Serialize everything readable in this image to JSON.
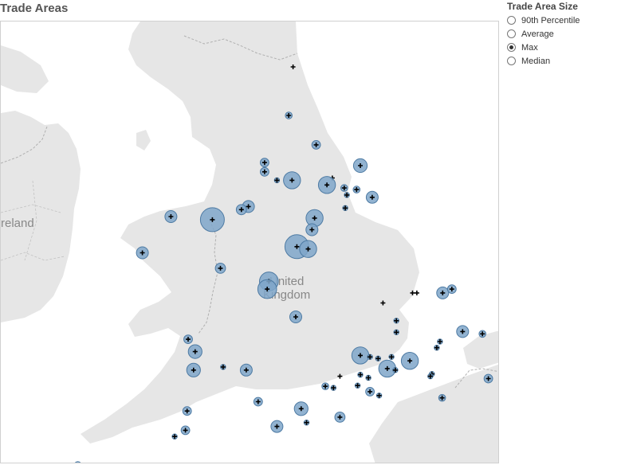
{
  "title": "Trade Areas",
  "legend": {
    "title": "Trade Area Size",
    "options": [
      "90th Percentile",
      "Average",
      "Max",
      "Median"
    ],
    "selected": "Max"
  },
  "map_labels": {
    "ireland": "reland",
    "uk_line1": "United",
    "uk_line2": "Kingdom"
  },
  "colors": {
    "land": "#e6e6e6",
    "sea": "#ffffff",
    "trade_area_fill": "#7fa6c9",
    "trade_area_stroke": "#4d7aa3",
    "store_marker": "#000000"
  },
  "trade_areas": [
    {
      "lat": 55.26,
      "lon": -1.55,
      "radius_km": 0
    },
    {
      "lat": 54.63,
      "lon": -1.63,
      "radius_km": 4
    },
    {
      "lat": 54.25,
      "lon": -1.12,
      "radius_km": 5
    },
    {
      "lat": 54.02,
      "lon": -2.08,
      "radius_km": 5
    },
    {
      "lat": 53.98,
      "lon": -0.3,
      "radius_km": 8
    },
    {
      "lat": 53.9,
      "lon": -2.08,
      "radius_km": 5
    },
    {
      "lat": 53.79,
      "lon": -1.85,
      "radius_km": 3
    },
    {
      "lat": 53.79,
      "lon": -1.57,
      "radius_km": 10
    },
    {
      "lat": 53.82,
      "lon": -0.82,
      "radius_km": 0
    },
    {
      "lat": 53.73,
      "lon": -0.92,
      "radius_km": 10
    },
    {
      "lat": 53.69,
      "lon": -0.6,
      "radius_km": 4
    },
    {
      "lat": 53.67,
      "lon": -0.37,
      "radius_km": 4
    },
    {
      "lat": 53.57,
      "lon": -0.08,
      "radius_km": 7
    },
    {
      "lat": 53.6,
      "lon": -0.55,
      "radius_km": 3
    },
    {
      "lat": 53.45,
      "lon": -2.38,
      "radius_km": 7
    },
    {
      "lat": 53.41,
      "lon": -2.51,
      "radius_km": 6
    },
    {
      "lat": 53.43,
      "lon": -0.58,
      "radius_km": 3
    },
    {
      "lat": 53.32,
      "lon": -3.82,
      "radius_km": 7
    },
    {
      "lat": 53.28,
      "lon": -3.05,
      "radius_km": 14
    },
    {
      "lat": 53.3,
      "lon": -1.15,
      "radius_km": 10
    },
    {
      "lat": 53.15,
      "lon": -1.2,
      "radius_km": 7
    },
    {
      "lat": 52.93,
      "lon": -1.48,
      "radius_km": 14
    },
    {
      "lat": 52.9,
      "lon": -1.27,
      "radius_km": 10
    },
    {
      "lat": 52.85,
      "lon": -4.35,
      "radius_km": 7
    },
    {
      "lat": 52.65,
      "lon": -2.9,
      "radius_km": 6
    },
    {
      "lat": 52.48,
      "lon": -2.0,
      "radius_km": 11
    },
    {
      "lat": 52.38,
      "lon": -2.03,
      "radius_km": 11
    },
    {
      "lat": 52.33,
      "lon": 1.23,
      "radius_km": 7
    },
    {
      "lat": 52.38,
      "lon": 1.4,
      "radius_km": 5
    },
    {
      "lat": 52.33,
      "lon": 0.75,
      "radius_km": 0
    },
    {
      "lat": 52.33,
      "lon": 0.67,
      "radius_km": 0
    },
    {
      "lat": 52.2,
      "lon": 0.12,
      "radius_km": 0
    },
    {
      "lat": 52.02,
      "lon": -1.5,
      "radius_km": 7
    },
    {
      "lat": 51.97,
      "lon": 0.37,
      "radius_km": 3
    },
    {
      "lat": 51.82,
      "lon": 0.37,
      "radius_km": 3
    },
    {
      "lat": 51.83,
      "lon": 1.6,
      "radius_km": 7
    },
    {
      "lat": 51.8,
      "lon": 1.97,
      "radius_km": 4
    },
    {
      "lat": 51.73,
      "lon": -3.5,
      "radius_km": 5
    },
    {
      "lat": 51.7,
      "lon": 1.18,
      "radius_km": 3
    },
    {
      "lat": 51.62,
      "lon": 1.12,
      "radius_km": 3
    },
    {
      "lat": 51.57,
      "lon": -3.37,
      "radius_km": 8
    },
    {
      "lat": 51.52,
      "lon": -0.3,
      "radius_km": 10
    },
    {
      "lat": 51.5,
      "lon": -0.12,
      "radius_km": 3
    },
    {
      "lat": 51.48,
      "lon": 0.03,
      "radius_km": 3
    },
    {
      "lat": 51.45,
      "lon": 0.62,
      "radius_km": 10
    },
    {
      "lat": 51.5,
      "lon": 0.28,
      "radius_km": 3
    },
    {
      "lat": 51.33,
      "lon": -3.4,
      "radius_km": 8
    },
    {
      "lat": 51.37,
      "lon": -2.85,
      "radius_km": 3
    },
    {
      "lat": 51.33,
      "lon": -2.42,
      "radius_km": 7
    },
    {
      "lat": 51.35,
      "lon": 0.2,
      "radius_km": 10
    },
    {
      "lat": 51.33,
      "lon": 0.35,
      "radius_km": 3
    },
    {
      "lat": 51.28,
      "lon": 1.03,
      "radius_km": 3
    },
    {
      "lat": 51.25,
      "lon": 1.0,
      "radius_km": 3
    },
    {
      "lat": 51.22,
      "lon": 2.08,
      "radius_km": 5
    },
    {
      "lat": 51.25,
      "lon": -0.68,
      "radius_km": 0
    },
    {
      "lat": 51.27,
      "lon": -0.3,
      "radius_km": 3
    },
    {
      "lat": 51.23,
      "lon": -0.15,
      "radius_km": 3
    },
    {
      "lat": 51.12,
      "lon": -0.95,
      "radius_km": 4
    },
    {
      "lat": 51.1,
      "lon": -0.8,
      "radius_km": 3
    },
    {
      "lat": 51.13,
      "lon": -0.35,
      "radius_km": 3
    },
    {
      "lat": 51.05,
      "lon": -0.12,
      "radius_km": 5
    },
    {
      "lat": 51.0,
      "lon": 0.05,
      "radius_km": 3
    },
    {
      "lat": 50.97,
      "lon": 1.22,
      "radius_km": 4
    },
    {
      "lat": 50.92,
      "lon": -2.2,
      "radius_km": 5
    },
    {
      "lat": 50.83,
      "lon": -1.4,
      "radius_km": 8
    },
    {
      "lat": 50.8,
      "lon": -3.52,
      "radius_km": 5
    },
    {
      "lat": 50.72,
      "lon": -0.68,
      "radius_km": 6
    },
    {
      "lat": 50.65,
      "lon": -1.3,
      "radius_km": 3
    },
    {
      "lat": 50.6,
      "lon": -1.85,
      "radius_km": 7
    },
    {
      "lat": 50.55,
      "lon": -3.55,
      "radius_km": 5
    },
    {
      "lat": 50.47,
      "lon": -3.75,
      "radius_km": 3
    },
    {
      "lat": 50.1,
      "lon": -5.55,
      "radius_km": 4
    }
  ]
}
